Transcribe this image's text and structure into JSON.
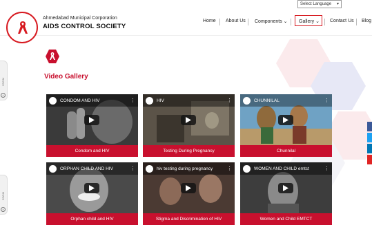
{
  "language_select": {
    "label": "Select Language"
  },
  "header": {
    "org_sub": "Ahmedabad Municipal Corporation",
    "org_main": "AIDS CONTROL SOCIETY",
    "logo_text": "AMC AIDS CONTROL SOCIETY"
  },
  "nav": {
    "items": [
      {
        "label": "Home"
      },
      {
        "label": "About Us"
      },
      {
        "label": "Components"
      },
      {
        "label": "Gallery"
      },
      {
        "label": "Contact Us"
      },
      {
        "label": "Blog"
      }
    ]
  },
  "zoom_label": "ZOOM",
  "section": {
    "title": "Video Gallery"
  },
  "videos": [
    {
      "title": "CONDOM AND HIV",
      "caption": "Condom and HIV"
    },
    {
      "title": "HIV",
      "caption": "Testing During Pregnancy"
    },
    {
      "title": "CHUNNILAL",
      "caption": "Chunnilal"
    },
    {
      "title": "ORPHAN CHILD AND HIV",
      "caption": "Orphan child and HIV"
    },
    {
      "title": "hiv testing during pregnancy",
      "caption": "Stigma and Discrimination of HIV"
    },
    {
      "title": "WOMEN AND CHILD emtct",
      "caption": "Women and Child EMTCT"
    }
  ],
  "colors": {
    "brand_red": "#c8102e",
    "social_facebook": "#3b5998",
    "social_twitter": "#1da1f2",
    "social_linkedin": "#0077b5",
    "social_youtube": "#e02424"
  }
}
